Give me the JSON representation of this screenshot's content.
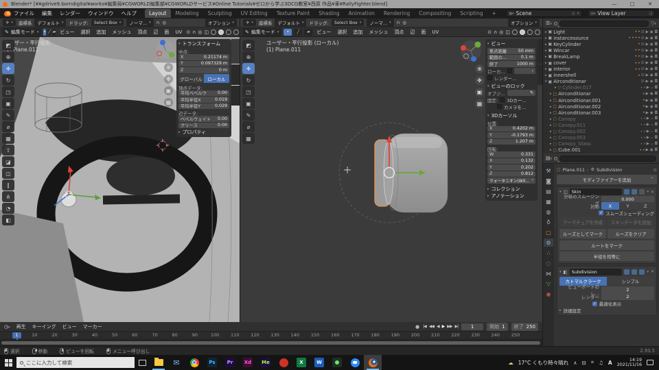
{
  "colors": {
    "accent_blue": "#4772b3",
    "selection_orange": "#e9944d",
    "axis_x_red": "#e0433c",
    "axis_y_green": "#6cab3e",
    "axis_z_blue": "#3f6fd0",
    "blender_orange": "#f26b21"
  },
  "window": {
    "title": "Blender* [¥¥gdrive9.borndigital¥works¥編集局¥CGWORLD編集部¥CGWORLDサービス¥Online Tutorials¥ゼロから学ぶ3DCG教室¥西原 作品¥車¥RallyFighter.blend]",
    "minimize": "—",
    "maximize": "□",
    "close": "✕"
  },
  "topbar": {
    "menus": [
      "ファイル",
      "編集",
      "レンダー",
      "ウィンドウ",
      "ヘルプ"
    ],
    "workspaces": [
      "Layout",
      "Modeling",
      "Sculpting",
      "UV Editing",
      "Texture Paint",
      "Shading",
      "Animation",
      "Rendering",
      "Compositing",
      "Scripting"
    ],
    "active_workspace": "Layout",
    "add_workspace": "+",
    "scene_name": "Scene",
    "view_layer_name": "View Layer"
  },
  "tool_settings": {
    "orientation_label": "座標系",
    "orientation_value": "デフォルト",
    "drag_label": "ドラッグ:",
    "drag_value": "Select Box",
    "snap_value": "ノーマ...",
    "options_label": "オプション"
  },
  "viewport_header": {
    "mode_label": "編集モード",
    "menus": [
      "ビュー",
      "選択",
      "追加",
      "メッシュ",
      "頂点",
      "辺",
      "面",
      "UV"
    ]
  },
  "left_viewport": {
    "overlay_line1": "ユーザー・平行投影",
    "overlay_line2": "(1) Plane.011",
    "sidebar_tabs": [
      "アイテム",
      "ツール",
      "ビュー"
    ],
    "active_tab": "アイテム",
    "transform_panel": {
      "title": "トランスフォーム",
      "median_label": "中点:",
      "median_rows": [
        [
          "X",
          "0.21174 m"
        ],
        [
          "Y",
          "0.097329 m"
        ],
        [
          "Z",
          "0 m"
        ]
      ],
      "space_options": [
        "グローバル",
        "ローカル"
      ],
      "active_space": "ローカル",
      "vertex_label": "頂点データ:",
      "vertex_rows": [
        [
          "平均ベベルウ",
          "0.00"
        ],
        [
          "平均半径X",
          "0.019"
        ],
        [
          "平均半径Y",
          "0.029"
        ]
      ],
      "edge_label": "辺データ:",
      "edge_rows": [
        [
          "ベベルウェイト",
          "0.00"
        ],
        [
          "クリース",
          "0.00"
        ]
      ],
      "properties_label": "プロパティ"
    }
  },
  "right_viewport": {
    "overlay_line1": "ユーザー・平行投影 (ローカル)",
    "overlay_line2": "(1) Plane.011",
    "sidebar_tabs": [
      "アイテム",
      "ツール",
      "ビュー"
    ],
    "active_tab": "ビュー",
    "view_panel": {
      "title": "ビュー",
      "rows": [
        [
          "焦点距離",
          "50 mm"
        ],
        [
          "範囲の...",
          "0.1 m"
        ],
        [
          "終了",
          "1000 m"
        ]
      ],
      "local_camera_label": "ローカ...",
      "render_region_label": "レンダー...",
      "lock_title": "ビューのロック",
      "lock_object_label": "オブジ...",
      "fixed_label": "固定:",
      "lock_3d_cursor_label": "3Dカー...",
      "lock_camera_label": "カメラを..."
    },
    "cursor_panel": {
      "title": "3Dカーソル",
      "location_label": "位置:",
      "location_rows": [
        [
          "X",
          "0.4202 m"
        ],
        [
          "Y",
          "-0.1793 m"
        ],
        [
          "Z",
          "1.207 m"
        ]
      ],
      "rotation_label": "回転:",
      "rotation_rows": [
        [
          "W",
          "0.331"
        ],
        [
          "X",
          "0.132"
        ],
        [
          "Y",
          "0.202"
        ],
        [
          "Z",
          "0.812"
        ]
      ],
      "rotation_mode": "クォータニオン(WX..."
    },
    "collection_panel_title": "コレクション",
    "annotation_panel_title": "アノテーション"
  },
  "outliner": {
    "rows": [
      {
        "name": "Light",
        "kind": "collection",
        "badges": 2
      },
      {
        "name": "instancesource",
        "kind": "collection",
        "badges": 4
      },
      {
        "name": "KeyCylinder",
        "kind": "collection",
        "badges": 1
      },
      {
        "name": "Wincar",
        "kind": "collection",
        "badges": 2
      },
      {
        "name": "BreakLamp",
        "kind": "collection",
        "badges": 2
      },
      {
        "name": "cover",
        "kind": "collection",
        "badges": 2
      },
      {
        "name": "interior",
        "kind": "collection",
        "badges": 2
      },
      {
        "name": "innershell",
        "kind": "collection",
        "badges": 1
      },
      {
        "name": "Airconditionar",
        "kind": "collection",
        "badges": 0,
        "expanded": true
      },
      {
        "name": "Cylinder.017",
        "kind": "mesh",
        "dim": true,
        "indent": 2,
        "badges": 2
      },
      {
        "name": "Airconditionar",
        "kind": "object",
        "indent": 1,
        "badges": 1
      },
      {
        "name": "Airconditionar.001",
        "kind": "object",
        "indent": 1,
        "badges": 1
      },
      {
        "name": "Airconditionar.002",
        "kind": "object",
        "indent": 1,
        "badges": 1
      },
      {
        "name": "Airconditionar.003",
        "kind": "object",
        "indent": 1,
        "badges": 1
      },
      {
        "name": "Canopy",
        "kind": "object",
        "dim": true,
        "indent": 1,
        "badges": 2
      },
      {
        "name": "Canopy.011",
        "kind": "object",
        "dim": true,
        "indent": 1,
        "badges": 2
      },
      {
        "name": "Canopy.002",
        "kind": "object",
        "dim": true,
        "indent": 1,
        "badges": 2
      },
      {
        "name": "Canopy.003",
        "kind": "object",
        "dim": true,
        "indent": 1,
        "badges": 2
      },
      {
        "name": "Canopy_Glass",
        "kind": "object",
        "dim": true,
        "indent": 1,
        "badges": 2
      },
      {
        "name": "Cube.001",
        "kind": "object",
        "indent": 1,
        "badges": 2
      }
    ]
  },
  "properties": {
    "breadcrumb_object": "Plane.011",
    "breadcrumb_modifier": "Subdivision",
    "add_modifier_label": "モディファイアーを追加",
    "skin": {
      "name": "Skin",
      "branch_label": "分岐のスムージング",
      "branch_value": "0.000",
      "symmetry_label": "対称",
      "axes": [
        "X",
        "Y",
        "Z"
      ],
      "active_axis": "X",
      "smooth_shading_label": "スムーズシェーディング",
      "smooth_shading_checked": true,
      "row1_buttons": [
        "アーマチュアを作成",
        "スキンデータを追加"
      ],
      "row2_buttons": [
        "ルーズとしてマーク",
        "ルーズをクリア"
      ],
      "mark_root_label": "ルートをマーク",
      "equalize_label": "半径を均等に"
    },
    "subdivision": {
      "name": "Subdivision",
      "type_options": [
        "カトマルクラーク",
        "シンプル"
      ],
      "active_type": "カトマルクラーク",
      "viewport_label": "ビューポートのレ...",
      "viewport_value": "2",
      "render_label": "レンダー",
      "render_value": "2",
      "optimal_label": "最適化表示",
      "optimal_checked": true,
      "advanced_label": "詳細設定"
    }
  },
  "timeline": {
    "menus": [
      "再生",
      "キーイング",
      "ビュー",
      "マーカー"
    ],
    "current_frame": "1",
    "start_label": "開始",
    "start_value": "1",
    "end_label": "終了",
    "end_value": "250",
    "tick_step": 10,
    "tick_max": 250
  },
  "statusbar": {
    "hints": [
      "選択",
      "移動",
      "ビューを回転",
      "メニュー呼び出し"
    ],
    "version": "2.93.5"
  },
  "taskbar": {
    "search_placeholder": "ここに入力して検索",
    "apps": [
      "explorer",
      "mail",
      "chrome",
      "photoshop",
      "premiere",
      "xd",
      "media-encoder",
      "rush",
      "excel",
      "word",
      "evernote",
      "zoom",
      "blender"
    ],
    "active_app": "blender",
    "tray": {
      "weather": "17°C くもり時々晴れ",
      "ime": "A",
      "time": "14:19",
      "date": "2021/11/16"
    }
  }
}
